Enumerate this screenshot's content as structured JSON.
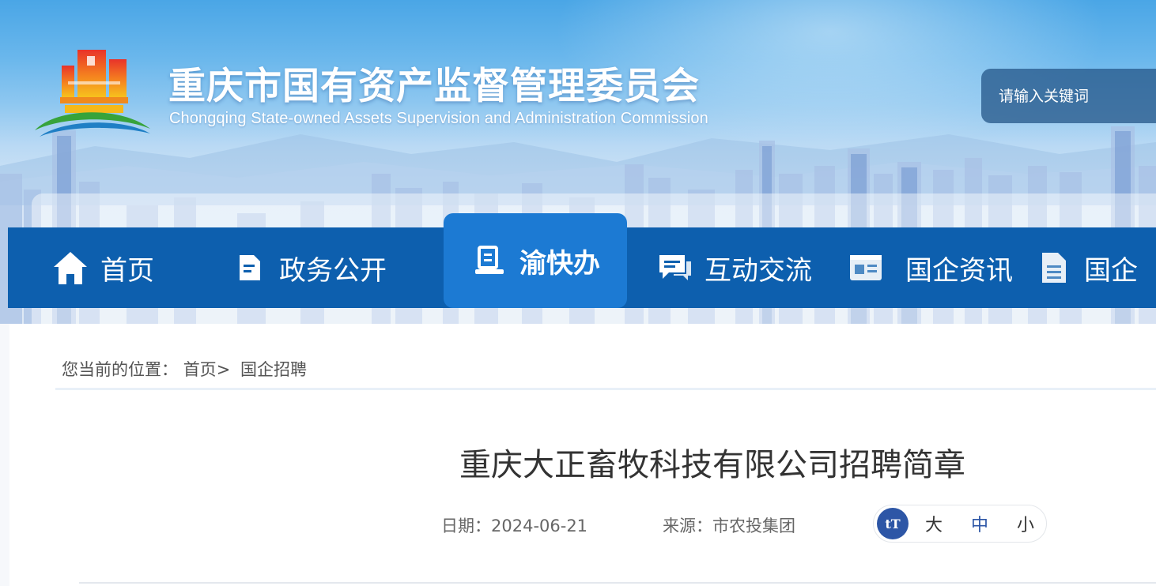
{
  "header": {
    "title": "重庆市国有资产监督管理委员会",
    "subtitle": "Chongqing State-owned Assets Supervision and Administration Commission",
    "logo_icon": "sasac-building-logo-icon"
  },
  "search": {
    "placeholder": "请输入关键词"
  },
  "nav": {
    "items": [
      {
        "label": "首页",
        "icon": "home-icon",
        "active": false
      },
      {
        "label": "政务公开",
        "icon": "document-icon",
        "active": false
      },
      {
        "label": "渝快办",
        "icon": "service-desk-icon",
        "active": true
      },
      {
        "label": "互动交流",
        "icon": "chat-icon",
        "active": false
      },
      {
        "label": "国企资讯",
        "icon": "news-card-icon",
        "active": false
      },
      {
        "label": "国企",
        "icon": "file-list-icon",
        "active": false
      }
    ]
  },
  "breadcrumb": {
    "prefix": "您当前的位置：",
    "home": "首页",
    "separator": ">",
    "current": "国企招聘"
  },
  "article": {
    "title": "重庆大正畜牧科技有限公司招聘简章",
    "date_label": "日期：",
    "date": "2024-06-21",
    "source_label": "来源：",
    "source": "市农投集团"
  },
  "font_size": {
    "icon": "tT",
    "large": "大",
    "medium": "中",
    "small": "小",
    "selected": "中"
  },
  "colors": {
    "nav_bg": "#0d5fae",
    "nav_active": "#1c7ad3",
    "accent": "#2d56a6"
  }
}
